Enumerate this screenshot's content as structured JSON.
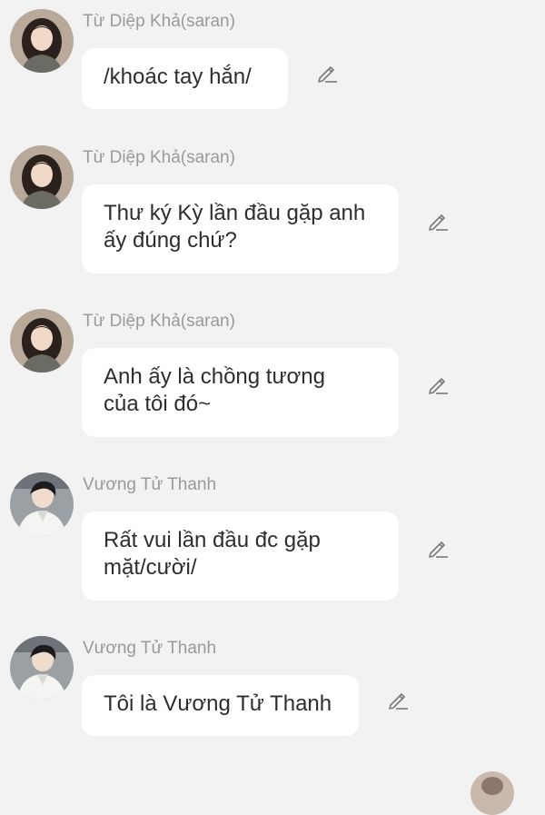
{
  "messages": [
    {
      "sender": "Từ Diệp Khả(saran)",
      "text": "/khoác tay hắn/",
      "avatar_icon": "avatar-girl"
    },
    {
      "sender": "Từ Diệp Khả(saran)",
      "text": "Thư ký Kỳ lần đầu gặp anh\nấy đúng chứ?",
      "avatar_icon": "avatar-girl"
    },
    {
      "sender": "Từ Diệp Khả(saran)",
      "text": "Anh ấy là chồng tương\ncủa tôi đó~",
      "avatar_icon": "avatar-girl"
    },
    {
      "sender": "Vương Tử Thanh",
      "text": "Rất vui lần đầu đc gặp\nmặt/cười/",
      "avatar_icon": "avatar-boy"
    },
    {
      "sender": "Vương Tử Thanh",
      "text": "Tôi là Vương Tử Thanh",
      "avatar_icon": "avatar-boy"
    }
  ],
  "edit_icon": "pencil-icon",
  "colors": {
    "background": "#f2f2f2",
    "bubble": "#ffffff",
    "sender_name": "#9a9a9a",
    "message_text": "#2e2e2e",
    "icon": "#7a7a7a"
  }
}
